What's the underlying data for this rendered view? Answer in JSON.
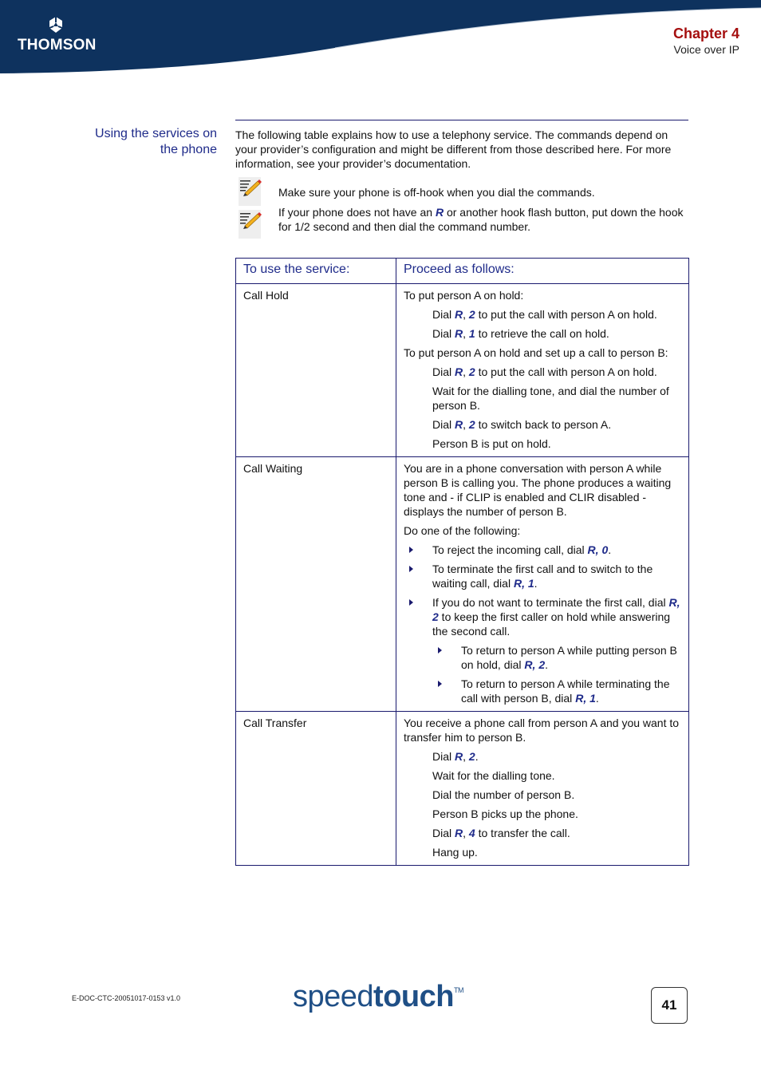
{
  "header": {
    "brand_logo": "THOMSON",
    "chapter_title": "Chapter 4",
    "chapter_subtitle": "Voice over IP",
    "band_color": "#0e325e",
    "chapter_color": "#a50f0f"
  },
  "section": {
    "heading_line1": "Using the services on",
    "heading_line2": "the phone",
    "intro": "The following table explains how to use a telephony service. The commands depend on your provider’s configuration and might be different from those described here. For more information, see your provider’s documentation."
  },
  "notes": [
    {
      "icon": "note-pencil-icon",
      "text": "Make sure your phone is off-hook when you dial the commands."
    },
    {
      "icon": "note-pencil-icon",
      "text_before": "If your phone does not have an ",
      "key": "R",
      "text_after": " or another hook flash button, put down the hook for 1/2 second and then dial the command number."
    }
  ],
  "table": {
    "headers": [
      "To use the service:",
      "Proceed as follows:"
    ],
    "rows": [
      {
        "service": "Call Hold",
        "steps": {
          "intro1": "To put person A on hold:",
          "s1": {
            "pre": "Dial ",
            "key": "R",
            "sep": ", ",
            "num": "2",
            "post": " to put the call with person A on hold."
          },
          "s2": {
            "pre": "Dial ",
            "key": "R",
            "sep": ", ",
            "num": "1",
            "post": " to retrieve the call on hold."
          },
          "intro2": "To put person A on hold and set up a call to person B:",
          "s3": {
            "pre": "Dial ",
            "key": "R",
            "sep": ", ",
            "num": "2",
            "post": " to put the call with person A on hold."
          },
          "s4": "Wait for the dialling tone, and dial the number of person B.",
          "s5": {
            "pre": "Dial ",
            "key": "R",
            "sep": ", ",
            "num": "2",
            "post": " to switch back to person A."
          },
          "s6": "Person B is put on hold."
        }
      },
      {
        "service": "Call Waiting",
        "steps": {
          "intro1": "You are in a phone conversation with person A while person B is calling you. The phone produces a waiting tone and - if CLIP is enabled and CLIR disabled - displays the number of person B.",
          "intro2": "Do one of the following:",
          "b1": {
            "pre": "To reject the incoming call, dial ",
            "key": "R",
            "sep": ", ",
            "num": "0",
            "post": "."
          },
          "b2": {
            "pre": "To terminate the first call and to switch to the waiting call, dial ",
            "key": "R",
            "sep": ", ",
            "num": "1",
            "post": "."
          },
          "b3": {
            "pre": "If you do not want to terminate the first call, dial ",
            "key": "R",
            "sep": ", ",
            "num": "2",
            "post": " to keep the first caller on hold while answering the second call."
          },
          "b3a": {
            "pre": "To return to person A while putting person B on hold, dial ",
            "key": "R",
            "sep": ", ",
            "num": "2",
            "post": "."
          },
          "b3b": {
            "pre": "To return to person A while terminating the call with person B, dial ",
            "key": "R",
            "sep": ", ",
            "num": "1",
            "post": "."
          }
        }
      },
      {
        "service": "Call Transfer",
        "steps": {
          "intro1": "You receive a phone call from person A and you want to transfer him to person B.",
          "s1": {
            "pre": "Dial ",
            "key": "R",
            "sep": ", ",
            "num": "2",
            "post": "."
          },
          "s2": "Wait for the dialling tone.",
          "s3": "Dial the number of person B.",
          "s4": "Person B picks up the phone.",
          "s5": {
            "pre": "Dial ",
            "key": "R",
            "sep": ", ",
            "num": "4",
            "post": " to transfer the call."
          },
          "s6": "Hang up."
        }
      }
    ]
  },
  "footer": {
    "doc_id": "E-DOC-CTC-20051017-0153 v1.0",
    "brand_light": "speed",
    "brand_bold": "touch",
    "trademark": "TM",
    "page_number": "41"
  }
}
